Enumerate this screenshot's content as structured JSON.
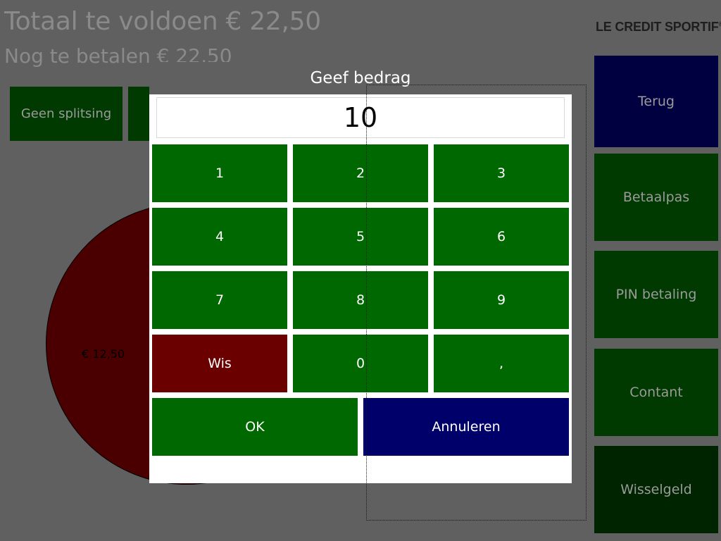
{
  "header": {
    "total_label": "Totaal te voldoen € 22,50",
    "remaining_label": "Nog te betalen € 22,50"
  },
  "brand": {
    "logo_text": "LE CREDIT SPORTIF",
    "logo_mark": "®"
  },
  "split": {
    "no_split_label": "Geen splitsing"
  },
  "pie": {
    "slice_label": "€ 12,50",
    "slice_color": "#4a0000"
  },
  "side_buttons": [
    {
      "label": "Terug",
      "color": "#000040"
    },
    {
      "label": "Betaalpas",
      "color": "#003a00"
    },
    {
      "label": "PIN betaling",
      "color": "#003a00"
    },
    {
      "label": "Contant",
      "color": "#003a00"
    },
    {
      "label": "Wisselgeld",
      "color": "#002400"
    }
  ],
  "dialog": {
    "title": "Geef bedrag",
    "amount_value": "10",
    "keys": {
      "k1": "1",
      "k2": "2",
      "k3": "3",
      "k4": "4",
      "k5": "5",
      "k6": "6",
      "k7": "7",
      "k8": "8",
      "k9": "9",
      "clear": "Wis",
      "k0": "0",
      "comma": ","
    },
    "ok_label": "OK",
    "cancel_label": "Annuleren"
  },
  "colors": {
    "key_green": "#006800",
    "key_red": "#6a0000",
    "key_blue": "#00006a",
    "overlay_gray": "#606060"
  }
}
